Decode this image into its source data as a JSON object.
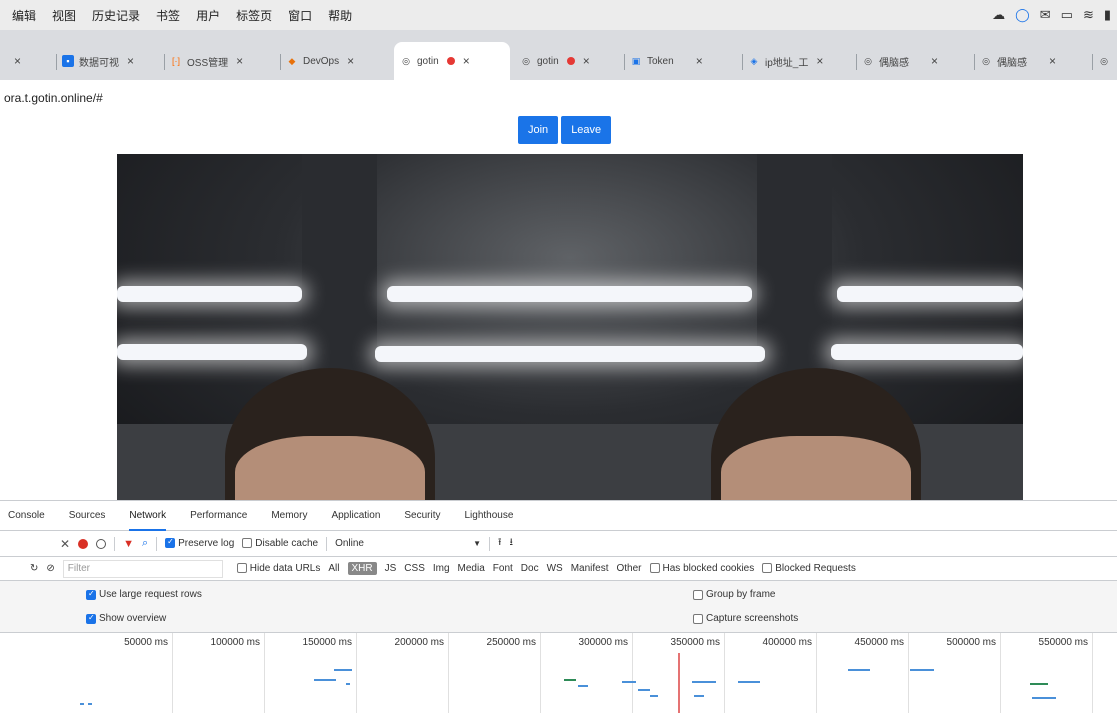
{
  "menubar": {
    "items": [
      "编辑",
      "视图",
      "历史记录",
      "书签",
      "用户",
      "标签页",
      "窗口",
      "帮助"
    ]
  },
  "tabs": [
    {
      "label": "",
      "favicon": "none"
    },
    {
      "label": "数据可视",
      "favicon": "doc-icon",
      "color": "#1a73e8"
    },
    {
      "label": "OSS管理",
      "favicon": "bracket-icon",
      "color": "#ff6a00"
    },
    {
      "label": "DevOps",
      "favicon": "devops-icon",
      "color": "#1a73e8"
    },
    {
      "label": "gotin",
      "favicon": "globe-icon",
      "color": "#444",
      "active": true,
      "recording": true
    },
    {
      "label": "gotin",
      "favicon": "globe-icon",
      "color": "#444",
      "recording": true
    },
    {
      "label": "Token",
      "favicon": "token-icon",
      "color": "#1a73e8"
    },
    {
      "label": "ip地址_工",
      "favicon": "network-icon",
      "color": "#1a73e8"
    },
    {
      "label": "偶脑感",
      "favicon": "globe-icon",
      "color": "#444"
    },
    {
      "label": "偶脑感",
      "favicon": "globe-icon",
      "color": "#444"
    }
  ],
  "address": {
    "url": "ora.t.gotin.online/#"
  },
  "page": {
    "join_label": "Join",
    "leave_label": "Leave"
  },
  "devtools": {
    "tabs": [
      "Console",
      "Sources",
      "Network",
      "Performance",
      "Memory",
      "Application",
      "Security",
      "Lighthouse"
    ],
    "active_tab": "Network",
    "toolbar": {
      "preserve_log": "Preserve log",
      "disable_cache": "Disable cache",
      "throttle": "Online"
    },
    "filter": {
      "placeholder": "Filter",
      "hide_data_urls": "Hide data URLs",
      "types": [
        "All",
        "XHR",
        "JS",
        "CSS",
        "Img",
        "Media",
        "Font",
        "Doc",
        "WS",
        "Manifest",
        "Other"
      ],
      "active_type": "XHR",
      "has_blocked_cookies": "Has blocked cookies",
      "blocked_requests": "Blocked Requests"
    },
    "settings": {
      "large_rows": "Use large request rows",
      "show_overview": "Show overview",
      "group_by_frame": "Group by frame",
      "capture_screenshots": "Capture screenshots"
    },
    "overview_ticks": [
      "50000 ms",
      "100000 ms",
      "150000 ms",
      "200000 ms",
      "250000 ms",
      "300000 ms",
      "350000 ms",
      "400000 ms",
      "450000 ms",
      "500000 ms",
      "550000 ms"
    ]
  }
}
